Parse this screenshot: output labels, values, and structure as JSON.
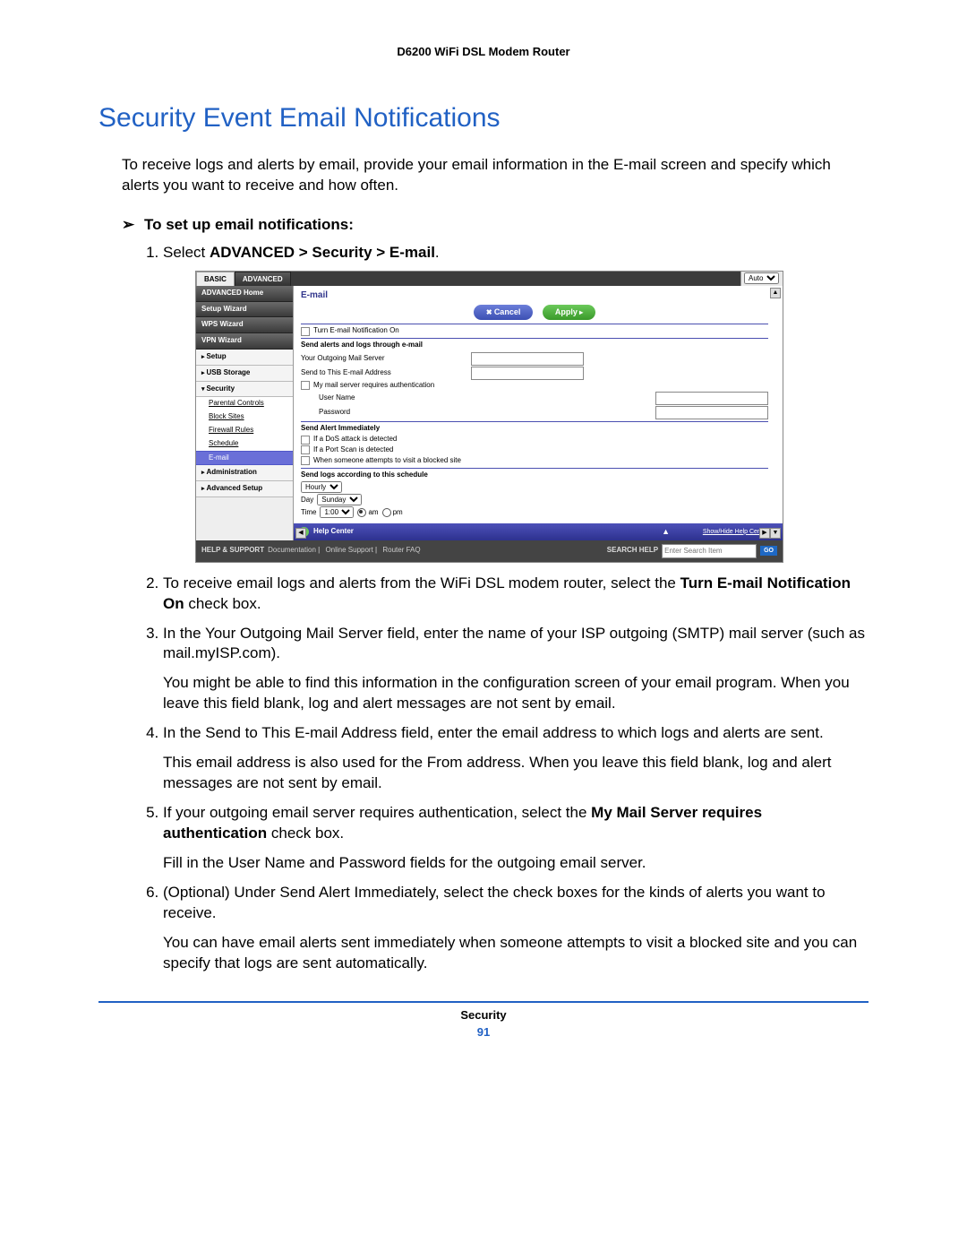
{
  "doc_header": "D6200 WiFi DSL Modem Router",
  "main_title": "Security Event Email Notifications",
  "intro": "To receive logs and alerts by email, provide your email information in the E-mail screen and specify which alerts you want to receive and how often.",
  "task_line": "To set up email notifications:",
  "steps": {
    "s1_pre": "Select ",
    "s1_bold": "ADVANCED > Security > E-mail",
    "s1_post": ".",
    "s2_pre": "To receive email logs and alerts from the WiFi DSL modem router, select the ",
    "s2_bold": "Turn E-mail Notification On",
    "s2_post": " check box.",
    "s3": "In the Your Outgoing Mail Server field, enter the name of your ISP outgoing (SMTP) mail server (such as mail.myISP.com).",
    "s3b": "You might be able to find this information in the configuration screen of your email program. When you leave this field blank, log and alert messages are not sent by email.",
    "s4": "In the Send to This E-mail Address field, enter the email address to which logs and alerts are sent.",
    "s4b": "This email address is also used for the From address. When you leave this field blank, log and alert messages are not sent by email.",
    "s5_pre": "If your outgoing email server requires authentication, select the ",
    "s5_bold": "My Mail Server requires authentication",
    "s5_post": " check box.",
    "s5b": "Fill in the User Name and Password fields for the outgoing email server.",
    "s6": "(Optional) Under Send Alert Immediately, select the check boxes for the kinds of alerts you want to receive.",
    "s6b": "You can have email alerts sent immediately when someone attempts to visit a blocked site and you can specify that logs are sent automatically."
  },
  "router": {
    "tab_basic": "BASIC",
    "tab_adv": "ADVANCED",
    "auto_label": "Auto",
    "nav": {
      "home": "ADVANCED Home",
      "setup_wiz": "Setup Wizard",
      "wps_wiz": "WPS Wizard",
      "vpn_wiz": "VPN Wizard",
      "setup": "Setup",
      "usb": "USB Storage",
      "security": "Security",
      "sub_parental": "Parental Controls",
      "sub_block": "Block Sites",
      "sub_firewall": "Firewall Rules",
      "sub_schedule": "Schedule",
      "sub_email": "E-mail",
      "admin": "Administration",
      "advsetup": "Advanced Setup"
    },
    "main": {
      "title": "E-mail",
      "btn_cancel": "Cancel",
      "btn_apply": "Apply",
      "turn_on": "Turn E-mail Notification On",
      "sec_send_alerts": "Send alerts and logs through e-mail",
      "outgoing": "Your Outgoing Mail Server",
      "sendto": "Send to This E-mail Address",
      "auth": "My mail server requires authentication",
      "user": "User Name",
      "pwd": "Password",
      "sec_immediate": "Send Alert Immediately",
      "dos": "If a DoS attack is detected",
      "portscan": "If a Port Scan is detected",
      "blocked": "When someone attempts to visit a blocked site",
      "sec_schedule": "Send logs according to this schedule",
      "freq": "Hourly",
      "day_lbl": "Day",
      "day_val": "Sunday",
      "time_lbl": "Time",
      "time_val": "1:00",
      "am": "am",
      "pm": "pm",
      "help_center": "Help Center",
      "showhide": "Show/Hide Help Center"
    },
    "footer": {
      "left": "HELP & SUPPORT",
      "l1": "Documentation",
      "l2": "Online Support",
      "l3": "Router FAQ",
      "right": "SEARCH HELP",
      "placeholder": "Enter Search Item",
      "go": "GO"
    }
  },
  "page_footer_section": "Security",
  "page_footer_num": "91"
}
